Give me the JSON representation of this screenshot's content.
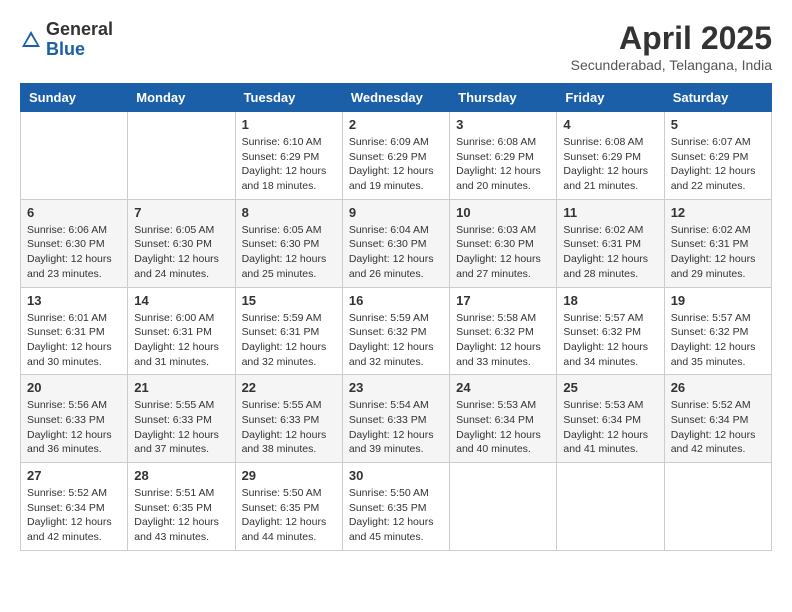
{
  "logo": {
    "general": "General",
    "blue": "Blue"
  },
  "header": {
    "month_year": "April 2025",
    "location": "Secunderabad, Telangana, India"
  },
  "weekdays": [
    "Sunday",
    "Monday",
    "Tuesday",
    "Wednesday",
    "Thursday",
    "Friday",
    "Saturday"
  ],
  "weeks": [
    [
      null,
      null,
      {
        "day": "1",
        "sunrise": "Sunrise: 6:10 AM",
        "sunset": "Sunset: 6:29 PM",
        "daylight": "Daylight: 12 hours and 18 minutes."
      },
      {
        "day": "2",
        "sunrise": "Sunrise: 6:09 AM",
        "sunset": "Sunset: 6:29 PM",
        "daylight": "Daylight: 12 hours and 19 minutes."
      },
      {
        "day": "3",
        "sunrise": "Sunrise: 6:08 AM",
        "sunset": "Sunset: 6:29 PM",
        "daylight": "Daylight: 12 hours and 20 minutes."
      },
      {
        "day": "4",
        "sunrise": "Sunrise: 6:08 AM",
        "sunset": "Sunset: 6:29 PM",
        "daylight": "Daylight: 12 hours and 21 minutes."
      },
      {
        "day": "5",
        "sunrise": "Sunrise: 6:07 AM",
        "sunset": "Sunset: 6:29 PM",
        "daylight": "Daylight: 12 hours and 22 minutes."
      }
    ],
    [
      {
        "day": "6",
        "sunrise": "Sunrise: 6:06 AM",
        "sunset": "Sunset: 6:30 PM",
        "daylight": "Daylight: 12 hours and 23 minutes."
      },
      {
        "day": "7",
        "sunrise": "Sunrise: 6:05 AM",
        "sunset": "Sunset: 6:30 PM",
        "daylight": "Daylight: 12 hours and 24 minutes."
      },
      {
        "day": "8",
        "sunrise": "Sunrise: 6:05 AM",
        "sunset": "Sunset: 6:30 PM",
        "daylight": "Daylight: 12 hours and 25 minutes."
      },
      {
        "day": "9",
        "sunrise": "Sunrise: 6:04 AM",
        "sunset": "Sunset: 6:30 PM",
        "daylight": "Daylight: 12 hours and 26 minutes."
      },
      {
        "day": "10",
        "sunrise": "Sunrise: 6:03 AM",
        "sunset": "Sunset: 6:30 PM",
        "daylight": "Daylight: 12 hours and 27 minutes."
      },
      {
        "day": "11",
        "sunrise": "Sunrise: 6:02 AM",
        "sunset": "Sunset: 6:31 PM",
        "daylight": "Daylight: 12 hours and 28 minutes."
      },
      {
        "day": "12",
        "sunrise": "Sunrise: 6:02 AM",
        "sunset": "Sunset: 6:31 PM",
        "daylight": "Daylight: 12 hours and 29 minutes."
      }
    ],
    [
      {
        "day": "13",
        "sunrise": "Sunrise: 6:01 AM",
        "sunset": "Sunset: 6:31 PM",
        "daylight": "Daylight: 12 hours and 30 minutes."
      },
      {
        "day": "14",
        "sunrise": "Sunrise: 6:00 AM",
        "sunset": "Sunset: 6:31 PM",
        "daylight": "Daylight: 12 hours and 31 minutes."
      },
      {
        "day": "15",
        "sunrise": "Sunrise: 5:59 AM",
        "sunset": "Sunset: 6:31 PM",
        "daylight": "Daylight: 12 hours and 32 minutes."
      },
      {
        "day": "16",
        "sunrise": "Sunrise: 5:59 AM",
        "sunset": "Sunset: 6:32 PM",
        "daylight": "Daylight: 12 hours and 32 minutes."
      },
      {
        "day": "17",
        "sunrise": "Sunrise: 5:58 AM",
        "sunset": "Sunset: 6:32 PM",
        "daylight": "Daylight: 12 hours and 33 minutes."
      },
      {
        "day": "18",
        "sunrise": "Sunrise: 5:57 AM",
        "sunset": "Sunset: 6:32 PM",
        "daylight": "Daylight: 12 hours and 34 minutes."
      },
      {
        "day": "19",
        "sunrise": "Sunrise: 5:57 AM",
        "sunset": "Sunset: 6:32 PM",
        "daylight": "Daylight: 12 hours and 35 minutes."
      }
    ],
    [
      {
        "day": "20",
        "sunrise": "Sunrise: 5:56 AM",
        "sunset": "Sunset: 6:33 PM",
        "daylight": "Daylight: 12 hours and 36 minutes."
      },
      {
        "day": "21",
        "sunrise": "Sunrise: 5:55 AM",
        "sunset": "Sunset: 6:33 PM",
        "daylight": "Daylight: 12 hours and 37 minutes."
      },
      {
        "day": "22",
        "sunrise": "Sunrise: 5:55 AM",
        "sunset": "Sunset: 6:33 PM",
        "daylight": "Daylight: 12 hours and 38 minutes."
      },
      {
        "day": "23",
        "sunrise": "Sunrise: 5:54 AM",
        "sunset": "Sunset: 6:33 PM",
        "daylight": "Daylight: 12 hours and 39 minutes."
      },
      {
        "day": "24",
        "sunrise": "Sunrise: 5:53 AM",
        "sunset": "Sunset: 6:34 PM",
        "daylight": "Daylight: 12 hours and 40 minutes."
      },
      {
        "day": "25",
        "sunrise": "Sunrise: 5:53 AM",
        "sunset": "Sunset: 6:34 PM",
        "daylight": "Daylight: 12 hours and 41 minutes."
      },
      {
        "day": "26",
        "sunrise": "Sunrise: 5:52 AM",
        "sunset": "Sunset: 6:34 PM",
        "daylight": "Daylight: 12 hours and 42 minutes."
      }
    ],
    [
      {
        "day": "27",
        "sunrise": "Sunrise: 5:52 AM",
        "sunset": "Sunset: 6:34 PM",
        "daylight": "Daylight: 12 hours and 42 minutes."
      },
      {
        "day": "28",
        "sunrise": "Sunrise: 5:51 AM",
        "sunset": "Sunset: 6:35 PM",
        "daylight": "Daylight: 12 hours and 43 minutes."
      },
      {
        "day": "29",
        "sunrise": "Sunrise: 5:50 AM",
        "sunset": "Sunset: 6:35 PM",
        "daylight": "Daylight: 12 hours and 44 minutes."
      },
      {
        "day": "30",
        "sunrise": "Sunrise: 5:50 AM",
        "sunset": "Sunset: 6:35 PM",
        "daylight": "Daylight: 12 hours and 45 minutes."
      },
      null,
      null,
      null
    ]
  ]
}
